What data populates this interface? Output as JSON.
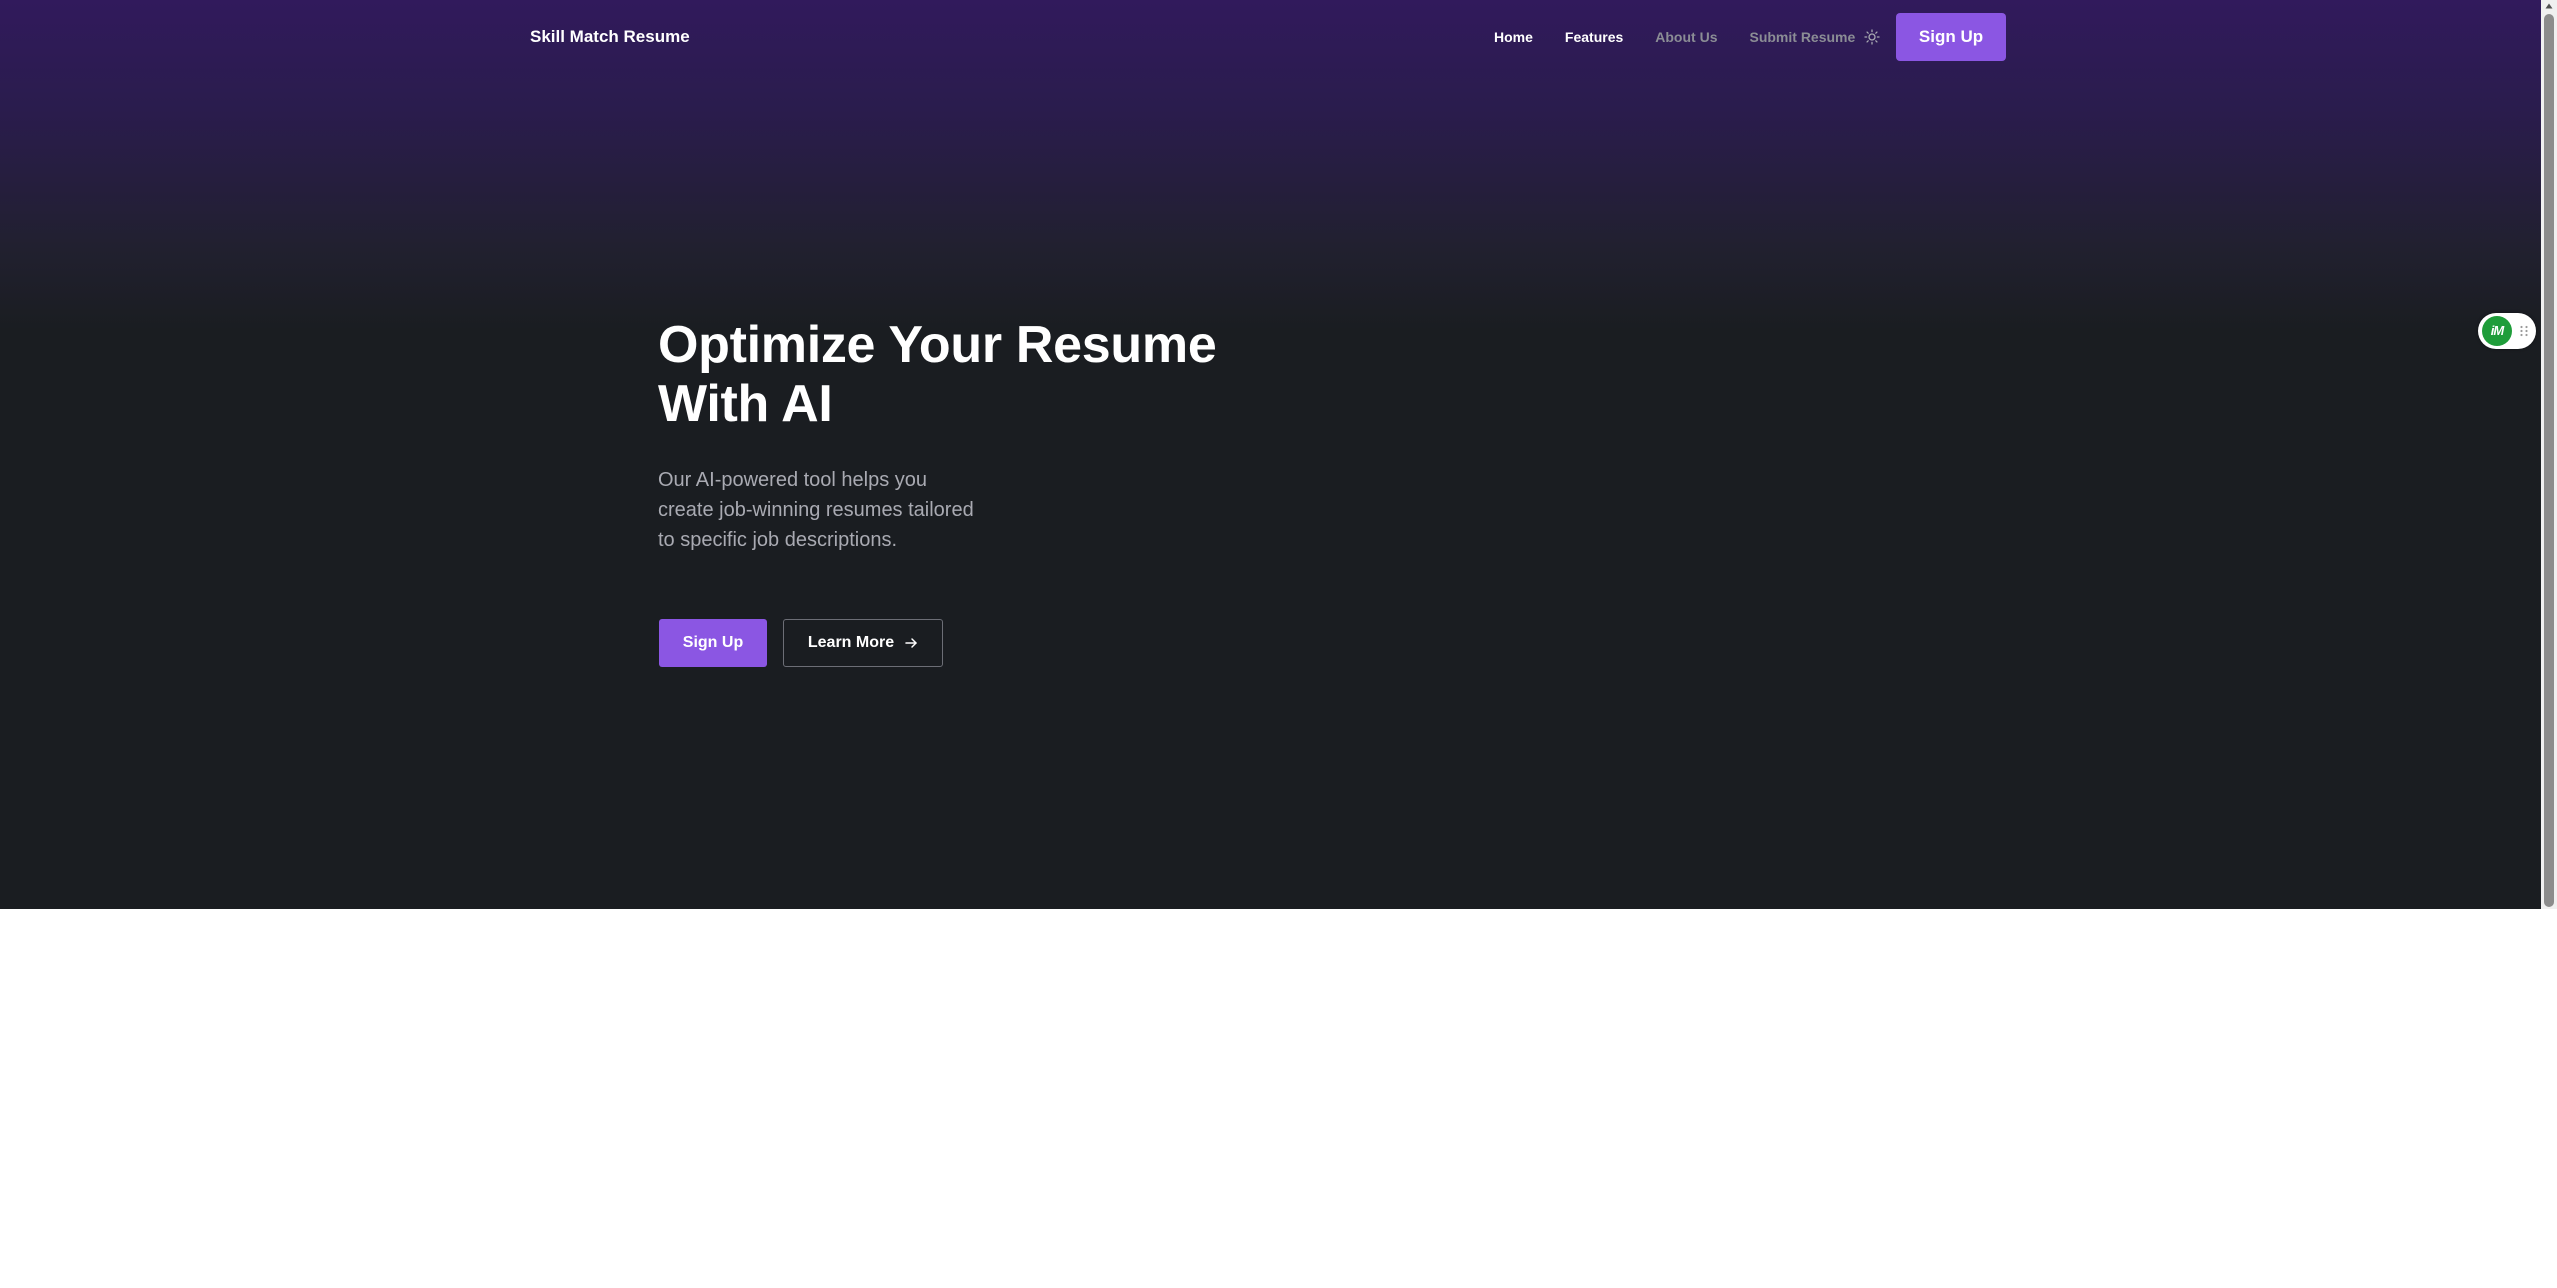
{
  "navbar": {
    "brand": "Skill Match Resume",
    "links": [
      {
        "label": "Home",
        "active": true
      },
      {
        "label": "Features",
        "active": false
      },
      {
        "label": "About Us",
        "active": false
      },
      {
        "label": "Submit Resume",
        "active": false
      }
    ],
    "theme_toggle_icon": "sun-icon",
    "signup_label": "Sign Up"
  },
  "hero": {
    "title_lines": [
      "Optimize Your Resume",
      "With AI"
    ],
    "description_lines": [
      "Our AI-powered tool helps you",
      "create job-winning resumes tailored",
      "to specific job descriptions."
    ],
    "primary_button": "Sign Up",
    "secondary_button": "Learn More",
    "secondary_button_icon": "arrow-right-icon"
  },
  "extension_widget": {
    "logo_text": "iM",
    "grip_icon": "drag-handle-icon"
  },
  "colors": {
    "accent": "#8b56e3",
    "hero_top": "#311a5c",
    "hero_bottom": "#1a1d21",
    "muted_text": "#a9aab2",
    "nav_inactive": "#8b8d95",
    "extension_green": "#1f9d3a"
  }
}
